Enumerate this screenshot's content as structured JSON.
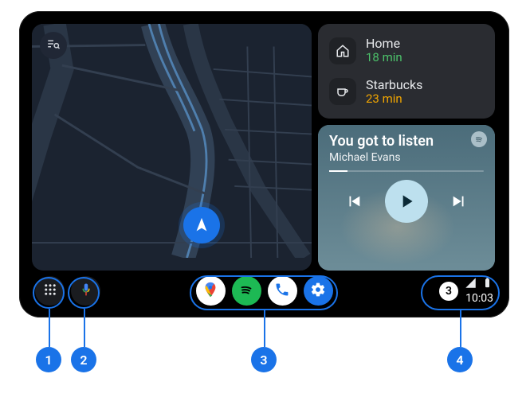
{
  "destinations": [
    {
      "label": "Home",
      "eta": "18 min",
      "eta_class": "green",
      "icon": "home-icon"
    },
    {
      "label": "Starbucks",
      "eta": "23 min",
      "eta_class": "amber",
      "icon": "coffee-icon"
    }
  ],
  "media": {
    "title": "You got to listen",
    "artist": "Michael Evans",
    "progress_pct": 12
  },
  "navbar": {
    "apps": [
      "maps",
      "spotify",
      "phone",
      "settings"
    ]
  },
  "status": {
    "notification_count": "3",
    "clock": "10:03"
  },
  "callouts": [
    "1",
    "2",
    "3",
    "4"
  ]
}
